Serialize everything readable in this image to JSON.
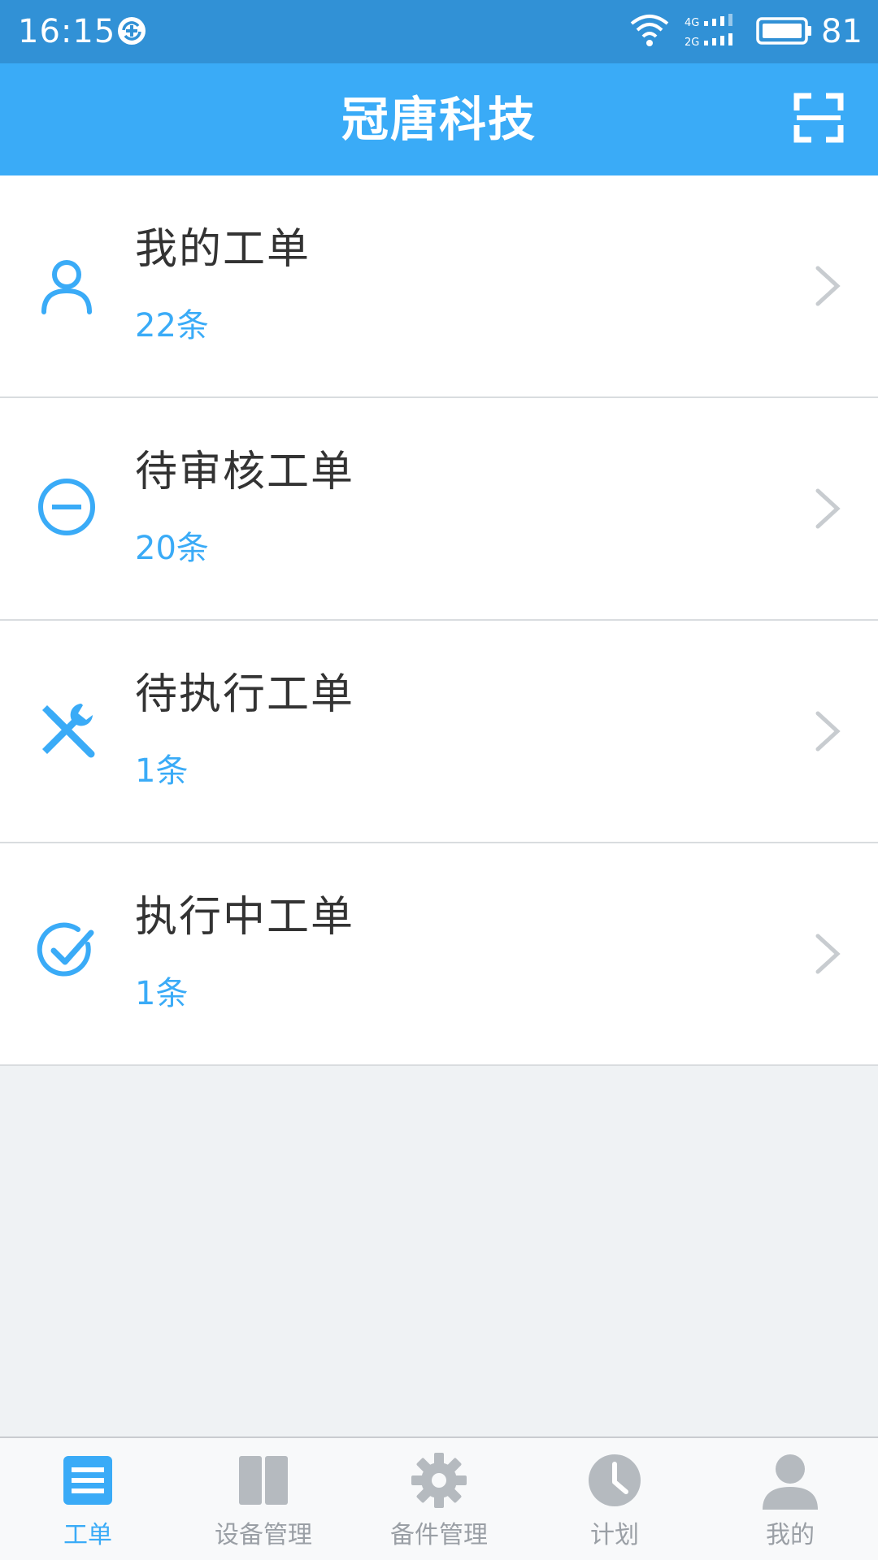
{
  "status_bar": {
    "time": "16:15",
    "battery_level": "81",
    "icons": [
      "sync-icon",
      "wifi-icon",
      "signal-icon",
      "battery-icon"
    ]
  },
  "header": {
    "title": "冠唐科技",
    "scan_icon": "scan-icon"
  },
  "work_orders": [
    {
      "title": "我的工单",
      "count": "22条",
      "icon": "user-icon"
    },
    {
      "title": "待审核工单",
      "count": "20条",
      "icon": "minus-circle-icon"
    },
    {
      "title": "待执行工单",
      "count": "1条",
      "icon": "tools-icon"
    },
    {
      "title": "执行中工单",
      "count": "1条",
      "icon": "check-circle-icon"
    }
  ],
  "tabs": [
    {
      "label": "工单",
      "icon": "list-icon",
      "active": true
    },
    {
      "label": "设备管理",
      "icon": "device-icon",
      "active": false
    },
    {
      "label": "备件管理",
      "icon": "gear-icon",
      "active": false
    },
    {
      "label": "计划",
      "icon": "clock-icon",
      "active": false
    },
    {
      "label": "我的",
      "icon": "person-icon",
      "active": false
    }
  ],
  "colors": {
    "status_bar": "#3191d6",
    "header": "#3aabf7",
    "accent": "#3aabf7",
    "inactive_tab": "#9a9fa5",
    "background": "#eff2f4"
  }
}
